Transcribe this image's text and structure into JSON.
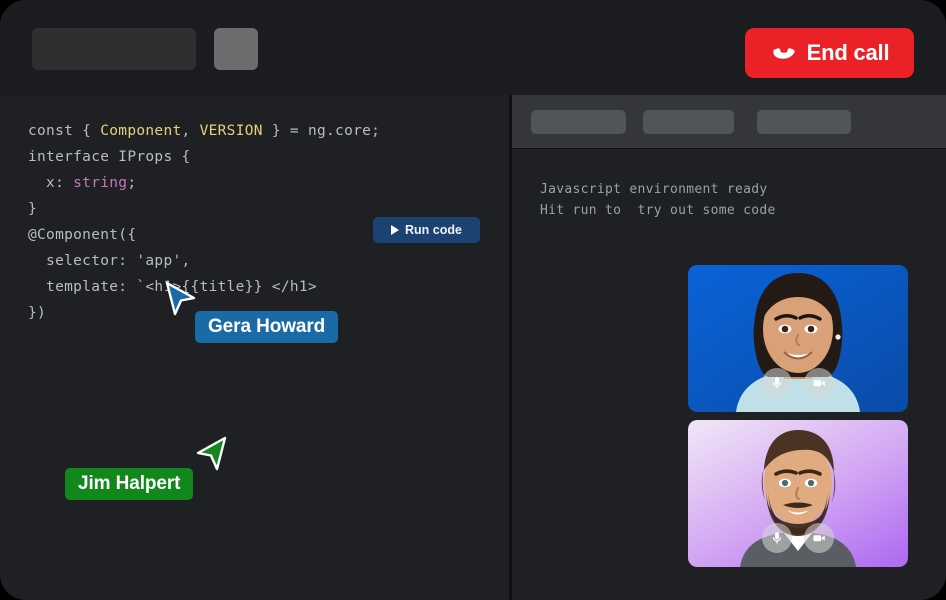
{
  "window": {
    "background": "#1b1c1f",
    "panel_background": "#1e2024"
  },
  "topbar": {
    "placeholder_wide": "",
    "placeholder_small": "",
    "end_call": {
      "label": "End call",
      "icon": "phone-hangup-icon",
      "color": "#ea2227"
    }
  },
  "editor": {
    "run_button": {
      "label": "Run code",
      "icon": "play-icon",
      "color": "#1c4272"
    },
    "code_lines": [
      [
        {
          "t": "const { ",
          "c": "plain"
        },
        {
          "t": "Component",
          "c": "hl"
        },
        {
          "t": ", ",
          "c": "plain"
        },
        {
          "t": "VERSION",
          "c": "hl"
        },
        {
          "t": " } = ng.core;",
          "c": "plain"
        }
      ],
      [
        {
          "t": "interface IProps {",
          "c": "plain"
        }
      ],
      [
        {
          "t": "  x: ",
          "c": "plain"
        },
        {
          "t": "string",
          "c": "type"
        },
        {
          "t": ";",
          "c": "plain"
        }
      ],
      [
        {
          "t": "}",
          "c": "plain"
        }
      ],
      [
        {
          "t": "@Component({",
          "c": "plain"
        }
      ],
      [
        {
          "t": "  selector: 'app',",
          "c": "plain"
        }
      ],
      [
        {
          "t": "  template: `<h1>{{title}} </h1>",
          "c": "plain"
        }
      ],
      [
        {
          "t": "})",
          "c": "plain"
        }
      ]
    ],
    "syntax_colors": {
      "plain": "#b9bcc0",
      "highlight": "#e6d07a",
      "type": "#c07ab8"
    }
  },
  "cursors": [
    {
      "name": "Gera Howard",
      "color": "#1a6aa8",
      "arrow_fill": "#1a6aa8"
    },
    {
      "name": "Jim Halpert",
      "color": "#12881c",
      "arrow_fill": "#12881c"
    }
  ],
  "right_panel": {
    "tabs": [
      "",
      "",
      ""
    ],
    "console_lines": [
      "Javascript environment ready",
      "Hit run to  try out some code"
    ],
    "video_tiles": [
      {
        "participant": "video-tile-1",
        "background": "#0a5fd0",
        "controls": [
          {
            "icon": "microphone-icon",
            "label": "mute"
          },
          {
            "icon": "camera-icon",
            "label": "camera"
          }
        ]
      },
      {
        "participant": "video-tile-2",
        "background": "#c58cf5",
        "controls": [
          {
            "icon": "microphone-icon",
            "label": "mute"
          },
          {
            "icon": "camera-icon",
            "label": "camera"
          }
        ]
      }
    ]
  }
}
